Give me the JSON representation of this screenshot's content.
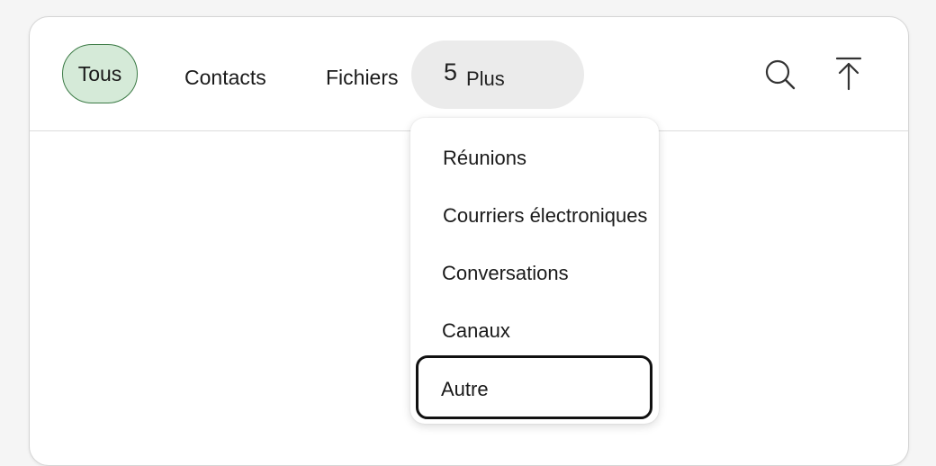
{
  "tabs": {
    "all_label": "Tous",
    "contacts_label": "Contacts",
    "files_label": "Fichiers",
    "more_count": "5",
    "more_label": "Plus"
  },
  "icons": {
    "search": "search-icon",
    "scroll_top": "arrow-up-to-line-icon"
  },
  "dropdown": {
    "items": [
      {
        "label": "Réunions"
      },
      {
        "label": "Courriers électroniques"
      },
      {
        "label": "Conversations"
      },
      {
        "label": "Canaux"
      },
      {
        "label": "Autre"
      }
    ],
    "focused_index": 4
  },
  "colors": {
    "selected_tab_bg": "#d5ead8",
    "selected_tab_border": "#3b7a45",
    "more_tab_bg": "#ebebeb",
    "focus_border": "#111111"
  }
}
